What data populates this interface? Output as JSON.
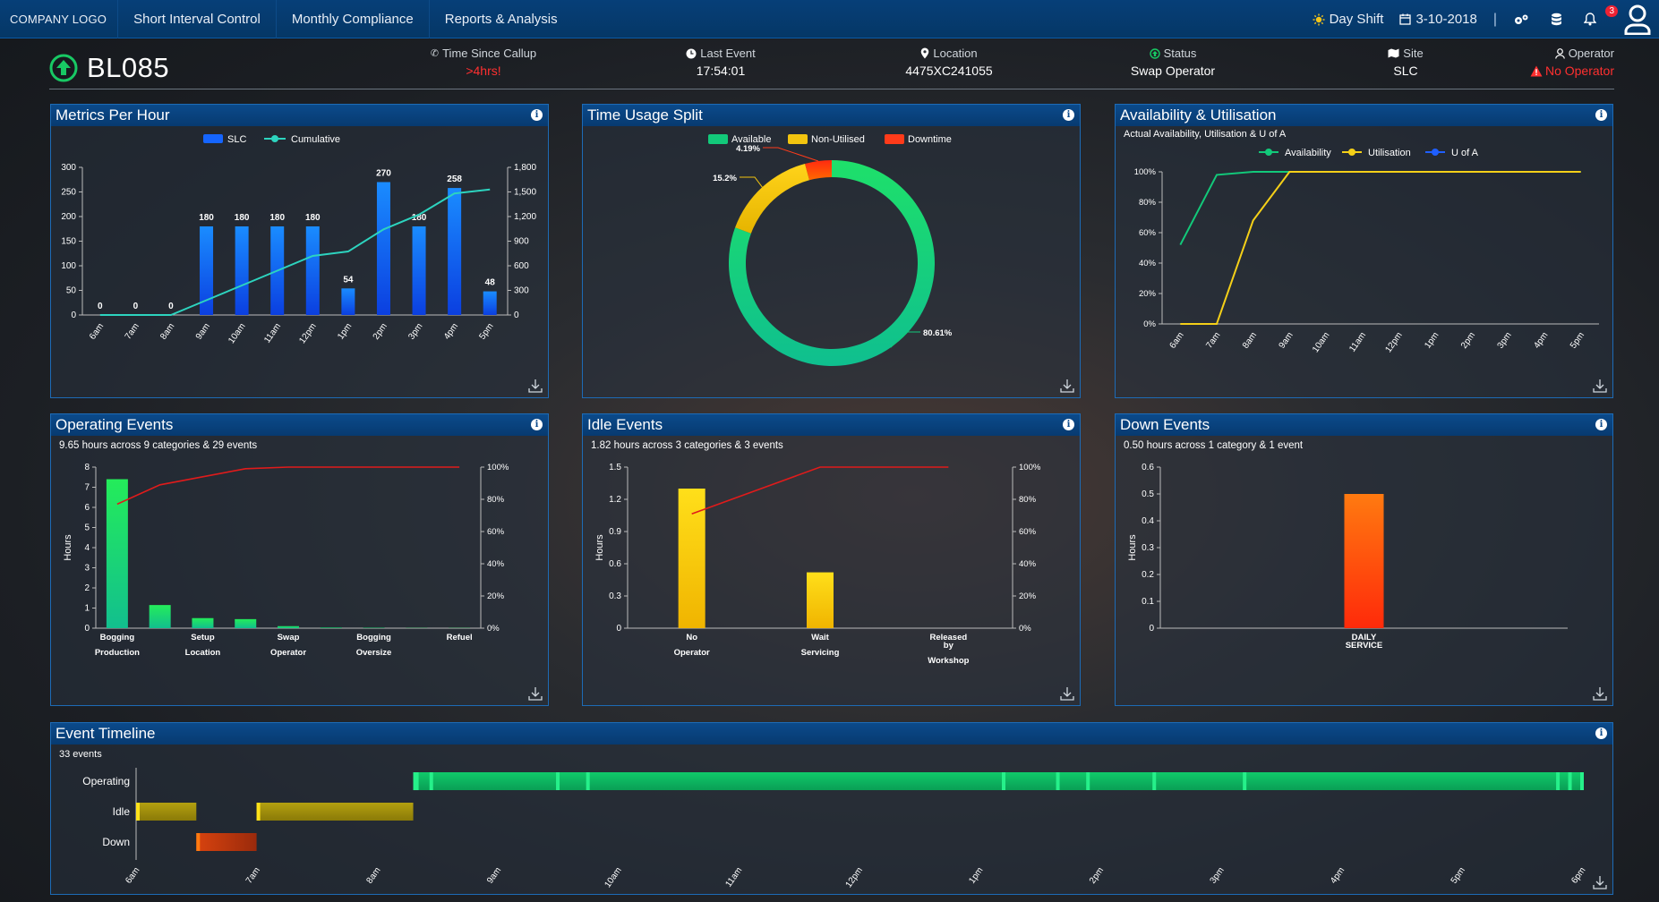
{
  "nav": {
    "logo": "COMPANY LOGO",
    "items": [
      "Short Interval Control",
      "Monthly Compliance",
      "Reports & Analysis"
    ],
    "shift": "Day Shift",
    "date": "3-10-2018",
    "separator": "|",
    "notification_count": "3",
    "icons": [
      "sun-icon",
      "calendar-icon",
      "settings-icon",
      "database-icon",
      "bell-icon",
      "user-icon"
    ]
  },
  "header": {
    "machine_id": "BL085",
    "fields": [
      {
        "label": "Time Since Callup",
        "value": ">4hrs!",
        "alert": true
      },
      {
        "label": "Last Event",
        "value": "17:54:01"
      },
      {
        "label": "Location",
        "value": "4475XC241055"
      },
      {
        "label": "Status",
        "value": "Swap Operator"
      },
      {
        "label": "Site",
        "value": "SLC"
      },
      {
        "label": "Operator",
        "value": "No Operator",
        "alert": true
      }
    ]
  },
  "panels": {
    "metrics": {
      "title": "Metrics Per Hour",
      "info": "i"
    },
    "time_usage": {
      "title": "Time Usage Split",
      "info": "i"
    },
    "availability": {
      "title": "Availability & Utilisation",
      "subtitle": "Actual Availability, Utilisation & U of A",
      "info": "i"
    },
    "operating": {
      "title": "Operating Events",
      "subtitle": "9.65 hours across 9 categories & 29 events",
      "info": "i"
    },
    "idle": {
      "title": "Idle Events",
      "subtitle": "1.82 hours across 3 categories & 3 events",
      "info": "i"
    },
    "down": {
      "title": "Down Events",
      "subtitle": "0.50 hours across 1 category & 1 event",
      "info": "i"
    },
    "timeline": {
      "title": "Event Timeline",
      "subtitle": "33 events",
      "info": "i"
    }
  },
  "colors": {
    "accent_blue": "#1d6bb6",
    "bar_blue": "#1565ff",
    "cumulative": "#2dd4bf",
    "available": "#12c97a",
    "non_utilised": "#f2c40f",
    "downtime": "#ff3b1a",
    "pareto_line": "#e01b1b",
    "alert_red": "#ff3030"
  },
  "chart_data": [
    {
      "id": "metrics",
      "type": "bar",
      "title": "Metrics Per Hour",
      "categories": [
        "6am",
        "7am",
        "8am",
        "9am",
        "10am",
        "11am",
        "12pm",
        "1pm",
        "2pm",
        "3pm",
        "4pm",
        "5pm"
      ],
      "series": [
        {
          "name": "SLC",
          "type": "bar",
          "axis": "left",
          "values": [
            0,
            0,
            0,
            180,
            180,
            180,
            180,
            54,
            270,
            180,
            258,
            48
          ]
        },
        {
          "name": "Cumulative",
          "type": "line",
          "axis": "right",
          "values": [
            0,
            0,
            0,
            180,
            360,
            540,
            720,
            774,
            1044,
            1224,
            1482,
            1530
          ]
        }
      ],
      "ylim_left": [
        0,
        300
      ],
      "yticks_left": [
        0,
        50,
        100,
        150,
        200,
        250,
        300
      ],
      "ylim_right": [
        0,
        1800
      ],
      "yticks_right": [
        "0",
        "300",
        "600",
        "900",
        "1,200",
        "1,500",
        "1,800"
      ],
      "data_labels": [
        "0",
        "0",
        "0",
        "180",
        "180",
        "180",
        "180",
        "54",
        "270",
        "180",
        "258",
        "48"
      ],
      "legend": "top-center"
    },
    {
      "id": "time_usage",
      "type": "pie",
      "title": "Time Usage Split",
      "categories": [
        "Available",
        "Non-Utilised",
        "Downtime"
      ],
      "values": [
        80.61,
        15.2,
        4.19
      ],
      "labels": [
        "80.61%",
        "15.2%",
        "4.19%"
      ],
      "legend": "top-center"
    },
    {
      "id": "availability",
      "type": "line",
      "title": "Availability & Utilisation",
      "categories": [
        "6am",
        "7am",
        "8am",
        "9am",
        "10am",
        "11am",
        "12pm",
        "1pm",
        "2pm",
        "3pm",
        "4pm",
        "5pm"
      ],
      "series": [
        {
          "name": "Availability",
          "values": [
            52,
            98,
            100,
            100,
            100,
            100,
            100,
            100,
            100,
            100,
            100,
            100
          ]
        },
        {
          "name": "Utilisation",
          "values": [
            0,
            0,
            68,
            100,
            100,
            100,
            100,
            100,
            100,
            100,
            100,
            100
          ]
        },
        {
          "name": "U of A",
          "values": []
        }
      ],
      "yticks": [
        "0%",
        "20%",
        "40%",
        "60%",
        "80%",
        "100%"
      ],
      "ylim": [
        0,
        100
      ],
      "legend": "top-center"
    },
    {
      "id": "operating",
      "type": "bar",
      "title": "Operating Events",
      "ylabel": "Hours",
      "categories": [
        "Bogging Production",
        "Setup Location",
        "Swap Operator",
        "Bogging Oversize",
        "Refuel"
      ],
      "tick_lines": [
        [
          "Bogging",
          "Production"
        ],
        [
          "Setup",
          "Location"
        ],
        [
          "Swap",
          "Operator"
        ],
        [
          "Bogging",
          "Oversize"
        ],
        [
          "Refuel",
          ""
        ]
      ],
      "values": [
        7.4,
        1.15,
        0.5,
        0.45,
        0.1,
        0.03,
        0.02,
        0.01,
        0.01
      ],
      "pareto": [
        77,
        89,
        94,
        99,
        100,
        100,
        100,
        100,
        100
      ],
      "ylim": [
        0,
        8
      ],
      "yticks": [
        "0",
        "1",
        "2",
        "3",
        "4",
        "5",
        "6",
        "7",
        "8"
      ],
      "y2ticks": [
        "0%",
        "20%",
        "40%",
        "60%",
        "80%",
        "100%"
      ]
    },
    {
      "id": "idle",
      "type": "bar",
      "title": "Idle Events",
      "ylabel": "Hours",
      "categories": [
        "No Operator",
        "Wait Servicing",
        "Released by Workshop"
      ],
      "tick_lines": [
        [
          "No",
          "Operator"
        ],
        [
          "Wait",
          "Servicing"
        ],
        [
          "Released",
          "by",
          "Workshop"
        ]
      ],
      "values": [
        1.3,
        0.52,
        0.0
      ],
      "pareto": [
        71,
        100,
        100
      ],
      "ylim": [
        0,
        1.5
      ],
      "yticks": [
        "0",
        "0.3",
        "0.6",
        "0.9",
        "1.2",
        "1.5"
      ],
      "y2ticks": [
        "0%",
        "20%",
        "40%",
        "60%",
        "80%",
        "100%"
      ]
    },
    {
      "id": "down",
      "type": "bar",
      "title": "Down Events",
      "ylabel": "Hours",
      "categories": [
        "DAILY SERVICE"
      ],
      "tick_lines": [
        [
          "DAILY",
          "SERVICE"
        ]
      ],
      "values": [
        0.5
      ],
      "ylim": [
        0,
        0.6
      ],
      "yticks": [
        "0",
        "0.1",
        "0.2",
        "0.3",
        "0.4",
        "0.5",
        "0.6"
      ]
    },
    {
      "id": "timeline",
      "type": "bar",
      "title": "Event Timeline",
      "rows": [
        "Operating",
        "Idle",
        "Down"
      ],
      "xticks": [
        "6am",
        "7am",
        "8am",
        "9am",
        "10am",
        "11am",
        "12pm",
        "1pm",
        "2pm",
        "3pm",
        "4pm",
        "5pm",
        "6pm"
      ],
      "events": [
        {
          "row": "Idle",
          "start": 6.0,
          "end": 6.5
        },
        {
          "row": "Down",
          "start": 6.5,
          "end": 7.0
        },
        {
          "row": "Idle",
          "start": 7.0,
          "end": 8.3
        },
        {
          "row": "Operating",
          "start": 8.3,
          "end": 18.0
        }
      ],
      "operating_markers": [
        8.33,
        8.45,
        9.5,
        9.75,
        13.2,
        13.65,
        13.9,
        14.45,
        15.2,
        17.8,
        17.9,
        18.0
      ]
    }
  ]
}
